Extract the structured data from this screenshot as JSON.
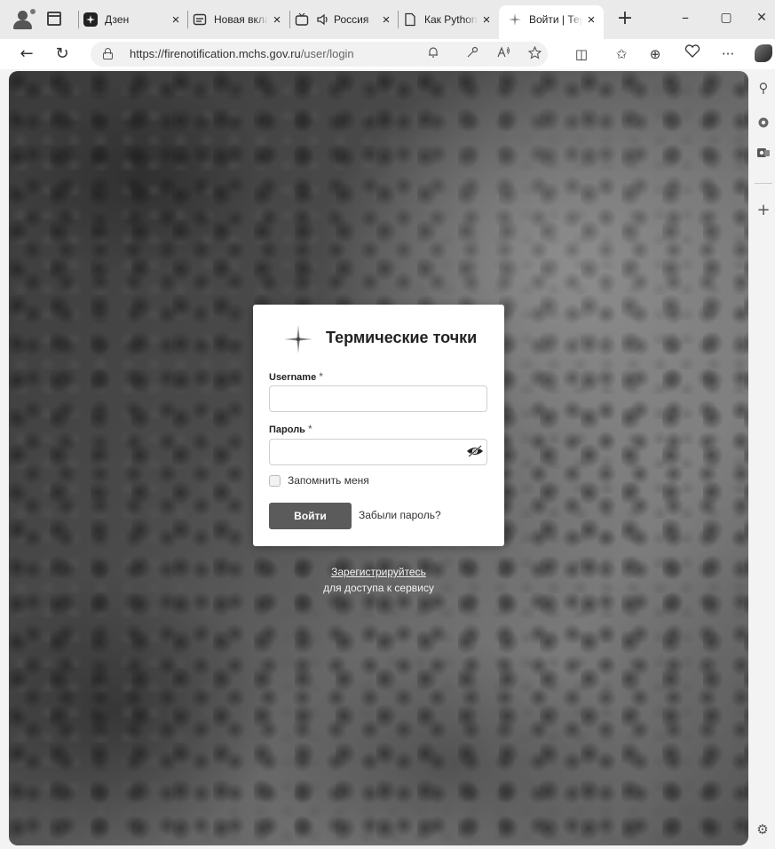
{
  "browser": {
    "tabs": [
      {
        "icon": "dzen-icon",
        "title": "Дзен",
        "active": false
      },
      {
        "icon": "newtab-icon",
        "title": "Новая вкладка",
        "active": false
      },
      {
        "icon": "tv-icon",
        "title": "Россия",
        "active": false
      },
      {
        "icon": "page-icon",
        "title": "Как Python",
        "active": false
      },
      {
        "icon": "spark-icon",
        "title": "Войти | Термические точки",
        "active": true
      }
    ],
    "tab_close_glyph": "×",
    "newtab_glyph": "+",
    "window_controls": {
      "minimize": "–",
      "maximize": "▢",
      "close": "✕"
    },
    "url_host": "https://firenotification.mchs.gov.ru",
    "url_path": "/user/login",
    "nav": {
      "back": "←",
      "refresh": "↻"
    },
    "toolbar_glyphs": {
      "split": "◫",
      "favorites": "✩",
      "collections": "⊕",
      "more": "···"
    }
  },
  "sidebar": {
    "glyphs": {
      "search": "⚲",
      "add": "+",
      "settings": "⚙"
    }
  },
  "login": {
    "brand_title": "Термические точки",
    "username_label": "Username",
    "username_value": "",
    "password_label": "Пароль",
    "password_value": "",
    "required_mark": "*",
    "remember_label": "Запомнить меня",
    "remember_checked": false,
    "submit_label": "Войти",
    "forgot_label": "Забыли пароль?",
    "register_link": "Зарегистрируйтесь",
    "register_subtext": "для доступа к сервису"
  },
  "colors": {
    "button_bg": "#5b5b5b",
    "card_bg": "#ffffff",
    "tab_strip": "#eaeaea"
  }
}
